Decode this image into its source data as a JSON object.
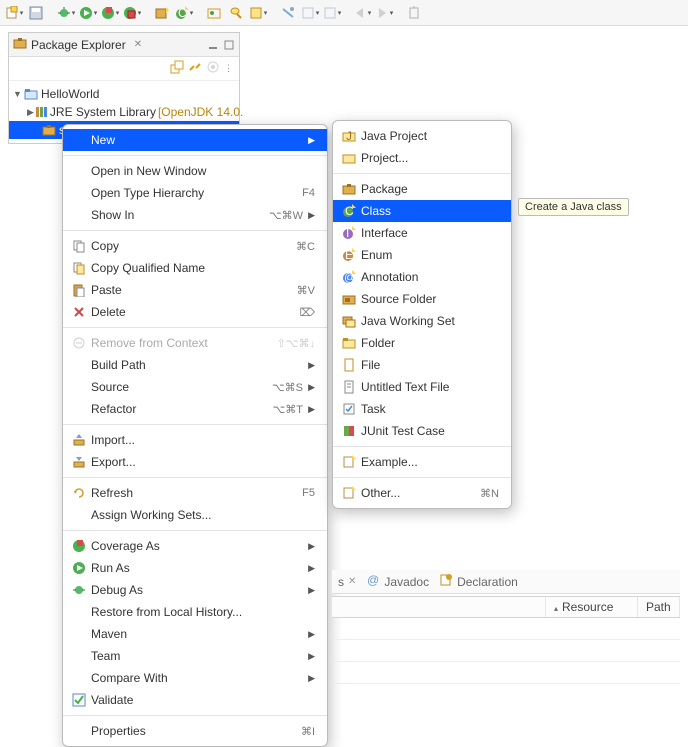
{
  "explorer": {
    "title": "Package Explorer",
    "close_glyph": "✕",
    "project": "HelloWorld",
    "jre_label": "JRE System Library",
    "jre_version": "[OpenJDK 14.0.",
    "src_label": "src"
  },
  "ctx_main": {
    "new": "New",
    "open_new_window": "Open in New Window",
    "open_type_hierarchy": "Open Type Hierarchy",
    "open_type_hierarchy_sc": "F4",
    "show_in": "Show In",
    "show_in_sc": "⌥⌘W",
    "copy": "Copy",
    "copy_sc": "⌘C",
    "copy_qualified": "Copy Qualified Name",
    "paste": "Paste",
    "paste_sc": "⌘V",
    "delete": "Delete",
    "delete_sc": "⌦",
    "remove_context": "Remove from Context",
    "remove_context_sc": "⇧⌥⌘↓",
    "build_path": "Build Path",
    "source": "Source",
    "source_sc": "⌥⌘S",
    "refactor": "Refactor",
    "refactor_sc": "⌥⌘T",
    "import": "Import...",
    "export": "Export...",
    "refresh": "Refresh",
    "refresh_sc": "F5",
    "assign_ws": "Assign Working Sets...",
    "coverage_as": "Coverage As",
    "run_as": "Run As",
    "debug_as": "Debug As",
    "restore_history": "Restore from Local History...",
    "maven": "Maven",
    "team": "Team",
    "compare_with": "Compare With",
    "validate": "Validate",
    "properties": "Properties",
    "properties_sc": "⌘I"
  },
  "ctx_new": {
    "java_project": "Java Project",
    "project": "Project...",
    "package": "Package",
    "class": "Class",
    "interface": "Interface",
    "enum": "Enum",
    "annotation": "Annotation",
    "source_folder": "Source Folder",
    "java_ws": "Java Working Set",
    "folder": "Folder",
    "file": "File",
    "untitled": "Untitled Text File",
    "task": "Task",
    "junit": "JUnit Test Case",
    "example": "Example...",
    "other": "Other...",
    "other_sc": "⌘N"
  },
  "tooltip": "Create a Java class",
  "bottom_tabs": {
    "tab0": "s",
    "tab1": "Javadoc",
    "tab2": "Declaration"
  },
  "table": {
    "col_resource": "Resource",
    "col_path": "Path"
  }
}
